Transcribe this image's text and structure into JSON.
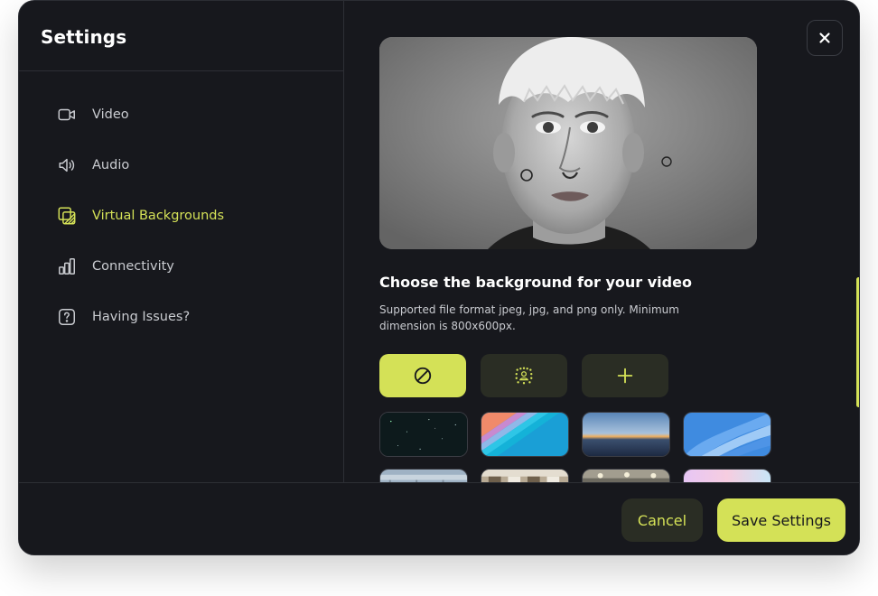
{
  "settings": {
    "title": "Settings"
  },
  "sidebar": {
    "items": [
      {
        "label": "Video",
        "icon": "video-icon",
        "active": false
      },
      {
        "label": "Audio",
        "icon": "speaker-icon",
        "active": false
      },
      {
        "label": "Virtual Backgrounds",
        "icon": "virtual-background-icon",
        "active": true
      },
      {
        "label": "Connectivity",
        "icon": "signal-bars-icon",
        "active": false
      },
      {
        "label": "Having Issues?",
        "icon": "question-icon",
        "active": false
      }
    ]
  },
  "background": {
    "title": "Choose the background for your video",
    "description": "Supported file format jpeg, jpg, and png only. Minimum dimension is 800x600px.",
    "options": [
      {
        "icon": "none-icon",
        "selected": true
      },
      {
        "icon": "blur-icon",
        "selected": false
      },
      {
        "icon": "plus-icon",
        "selected": false
      }
    ],
    "thumbnails": [
      "starfield",
      "layered-stripes",
      "horizon-sunset",
      "blue-waves",
      "office-glass",
      "office-room",
      "ceiling-lights",
      "pastel-gradient"
    ]
  },
  "footer": {
    "cancel_label": "Cancel",
    "save_label": "Save Settings"
  },
  "colors": {
    "accent": "#d4e157",
    "background": "#17181d",
    "muted_button": "#2a2d24"
  }
}
